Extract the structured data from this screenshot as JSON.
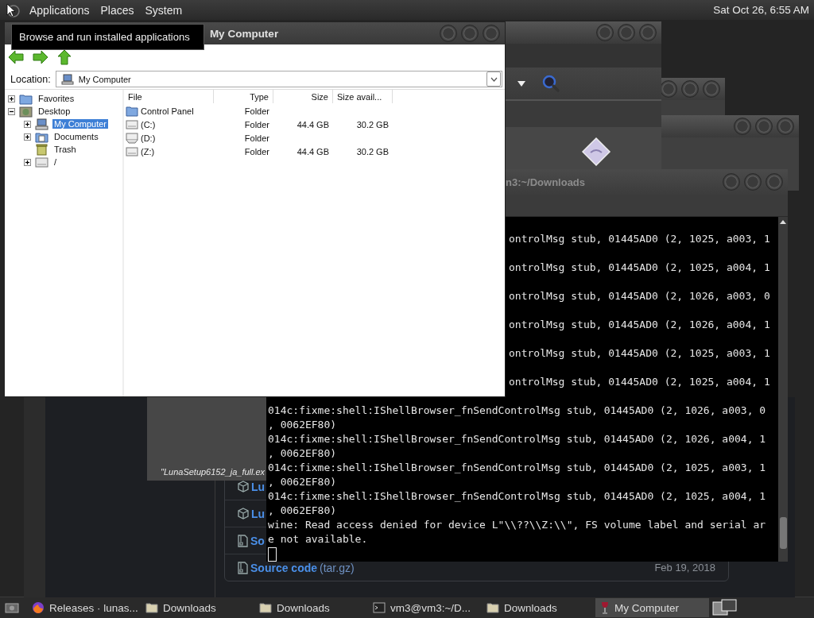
{
  "top_panel": {
    "menus": [
      "Applications",
      "Places",
      "System"
    ],
    "clock": "Sat Oct 26, 6:55 AM"
  },
  "tooltip": "Browse and run installed applications",
  "installer_window": {
    "caption": "\"LunaSetup6152_ja_full.ex"
  },
  "browser_page": {
    "rows": [
      {
        "kind": "package",
        "name": "Lu"
      },
      {
        "kind": "package",
        "name": "Lu"
      },
      {
        "kind": "source",
        "name": "So"
      },
      {
        "kind": "source",
        "name": "Source code",
        "suffix": "(tar.gz)",
        "date": "Feb 19, 2018"
      }
    ]
  },
  "terminal": {
    "title": "n3:~/Downloads",
    "lines": [
      {
        "kind": "partial",
        "text": "ontrolMsg stub, 01445AD0 (2, 1025, a003, 1"
      },
      {
        "kind": "partial",
        "text": "ontrolMsg stub, 01445AD0 (2, 1025, a004, 1"
      },
      {
        "kind": "partial",
        "text": "ontrolMsg stub, 01445AD0 (2, 1026, a003, 0"
      },
      {
        "kind": "partial",
        "text": "ontrolMsg stub, 01445AD0 (2, 1026, a004, 1"
      },
      {
        "kind": "partial",
        "text": "ontrolMsg stub, 01445AD0 (2, 1025, a003, 1"
      },
      {
        "kind": "partial",
        "text": "ontrolMsg stub, 01445AD0 (2, 1025, a004, 1"
      },
      {
        "kind": "full",
        "text": "014c:fixme:shell:IShellBrowser_fnSendControlMsg stub, 01445AD0 (2, 1026, a003, 0"
      },
      {
        "kind": "full",
        "text": ", 0062EF80)"
      },
      {
        "kind": "full",
        "text": "014c:fixme:shell:IShellBrowser_fnSendControlMsg stub, 01445AD0 (2, 1026, a004, 1"
      },
      {
        "kind": "full",
        "text": ", 0062EF80)"
      },
      {
        "kind": "full",
        "text": "014c:fixme:shell:IShellBrowser_fnSendControlMsg stub, 01445AD0 (2, 1025, a003, 1"
      },
      {
        "kind": "full",
        "text": ", 0062EF80)"
      },
      {
        "kind": "full",
        "text": "014c:fixme:shell:IShellBrowser_fnSendControlMsg stub, 01445AD0 (2, 1025, a004, 1"
      },
      {
        "kind": "full",
        "text": ", 0062EF80)"
      },
      {
        "kind": "full",
        "text": "wine: Read access denied for device L\"\\\\??\\\\Z:\\\\\", FS volume label and serial ar"
      },
      {
        "kind": "full",
        "text": "e not available."
      }
    ]
  },
  "file_manager": {
    "title": "My Computer",
    "location_label": "Location:",
    "location": "My Computer",
    "tree": [
      {
        "label": "Favorites",
        "kind": "favorites",
        "expanded": false,
        "selected": false
      },
      {
        "label": "Desktop",
        "kind": "desktop",
        "expanded": true,
        "selected": false,
        "children": [
          {
            "label": "My Computer",
            "kind": "computer",
            "expanded": false,
            "selected": true
          },
          {
            "label": "Documents",
            "kind": "documents",
            "expanded": false,
            "selected": false
          },
          {
            "label": "Trash",
            "kind": "trash",
            "selected": false
          },
          {
            "label": "/",
            "kind": "drive",
            "expanded": false,
            "selected": false
          }
        ]
      }
    ],
    "columns": [
      "File",
      "Type",
      "Size",
      "Size avail..."
    ],
    "rows": [
      {
        "kind": "folder",
        "file": "Control Panel",
        "type": "Folder"
      },
      {
        "kind": "drive",
        "file": "(C:)",
        "type": "Folder",
        "size": "44.4 GB",
        "size_avail": "30.2 GB"
      },
      {
        "kind": "cdrom",
        "file": "(D:)",
        "type": "Folder"
      },
      {
        "kind": "drive",
        "file": "(Z:)",
        "type": "Folder",
        "size": "44.4 GB",
        "size_avail": "30.2 GB"
      }
    ]
  },
  "taskbar": {
    "items": [
      {
        "kind": "browser",
        "label": "Releases · lunas...",
        "selected": false
      },
      {
        "kind": "folder",
        "label": "Downloads",
        "selected": false
      },
      {
        "kind": "folder",
        "label": "Downloads",
        "selected": false
      },
      {
        "kind": "terminal",
        "label": "vm3@vm3:~/D...",
        "selected": false
      },
      {
        "kind": "folder",
        "label": "Downloads",
        "selected": false
      },
      {
        "kind": "wine",
        "label": "My Computer",
        "selected": true
      }
    ]
  }
}
